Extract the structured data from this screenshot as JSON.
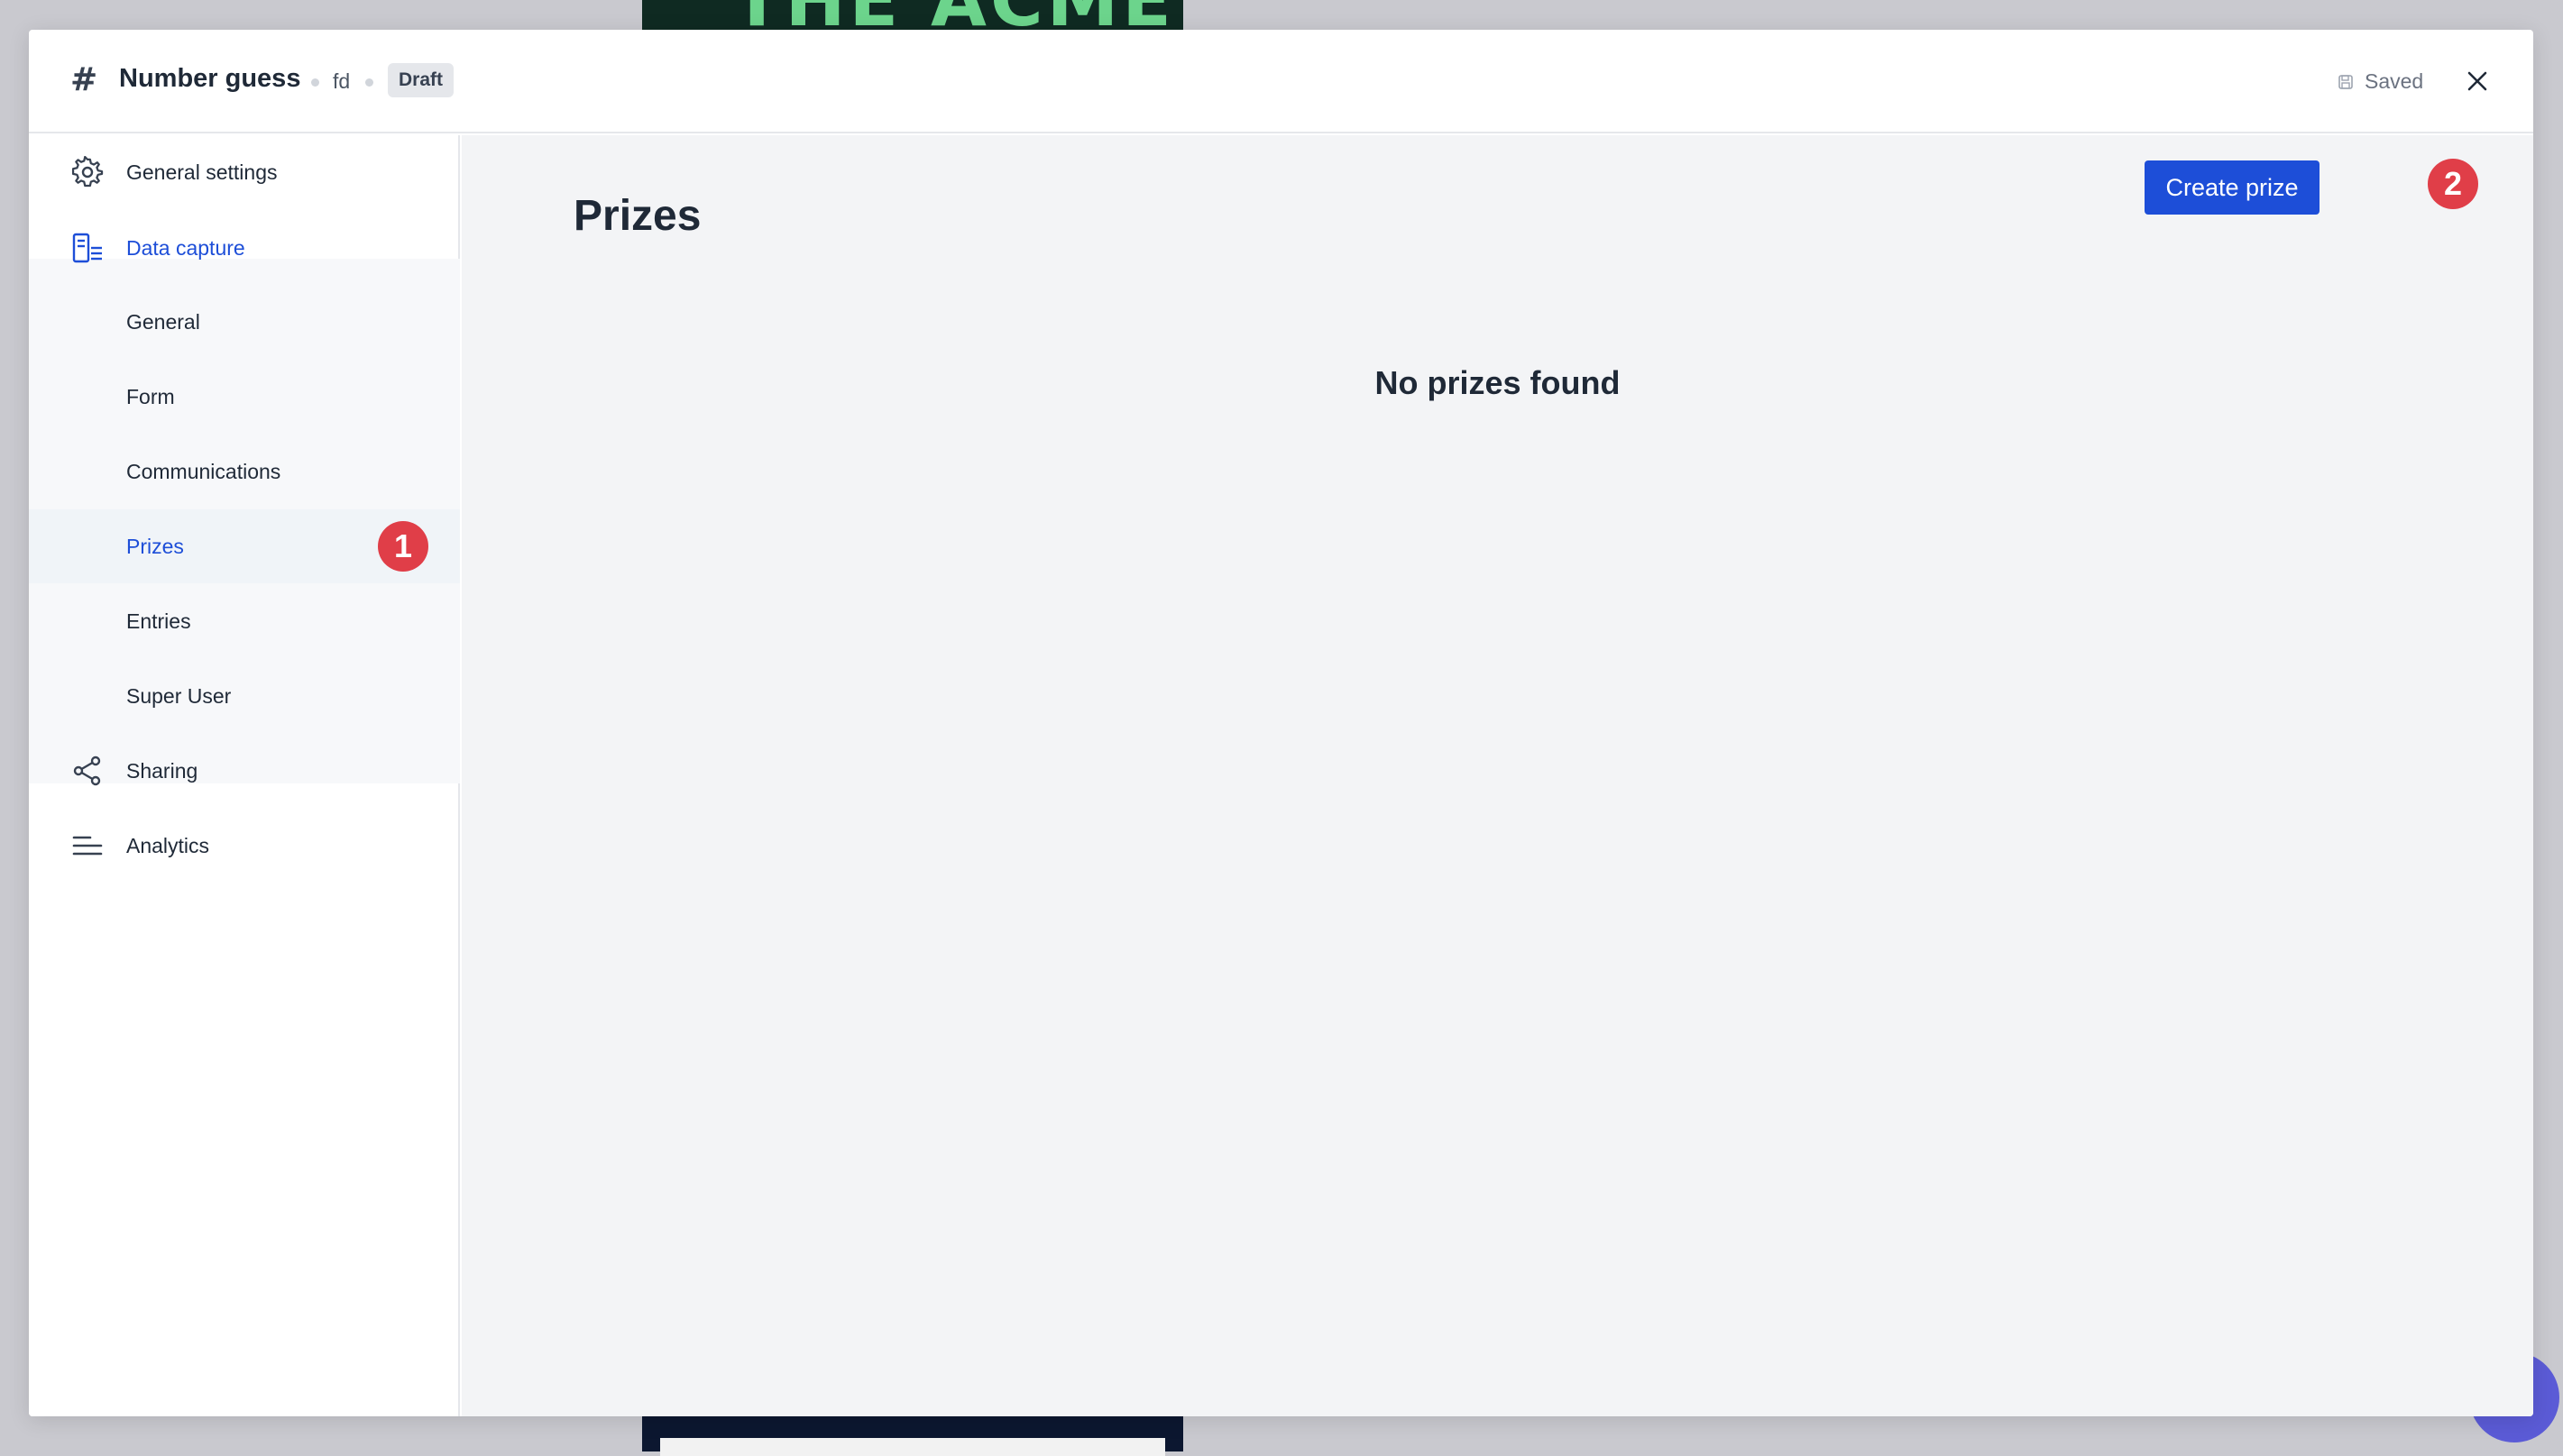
{
  "header": {
    "title": "Number guess",
    "owner": "fd",
    "status_badge": "Draft",
    "saved_label": "Saved",
    "icons": {
      "title_icon": "hash-icon",
      "saved_icon": "floppy-disk-icon",
      "close_icon": "close-icon"
    }
  },
  "sidebar": {
    "items": [
      {
        "label": "General settings",
        "icon": "gear-icon"
      },
      {
        "label": "Data capture",
        "icon": "form-icon"
      },
      {
        "label": "General"
      },
      {
        "label": "Form"
      },
      {
        "label": "Communications"
      },
      {
        "label": "Prizes"
      },
      {
        "label": "Entries"
      },
      {
        "label": "Super User"
      },
      {
        "label": "Sharing",
        "icon": "share-icon"
      },
      {
        "label": "Analytics",
        "icon": "lines-icon"
      }
    ],
    "active_section": "Data capture",
    "selected_item": "Prizes"
  },
  "main": {
    "page_title": "Prizes",
    "create_button_label": "Create prize",
    "empty_message": "No prizes found"
  },
  "annotations": {
    "step1": "1",
    "step2": "2"
  },
  "colors": {
    "accent": "#1d4ed8",
    "annotation": "#e03e48",
    "main_bg": "#f3f4f6"
  }
}
